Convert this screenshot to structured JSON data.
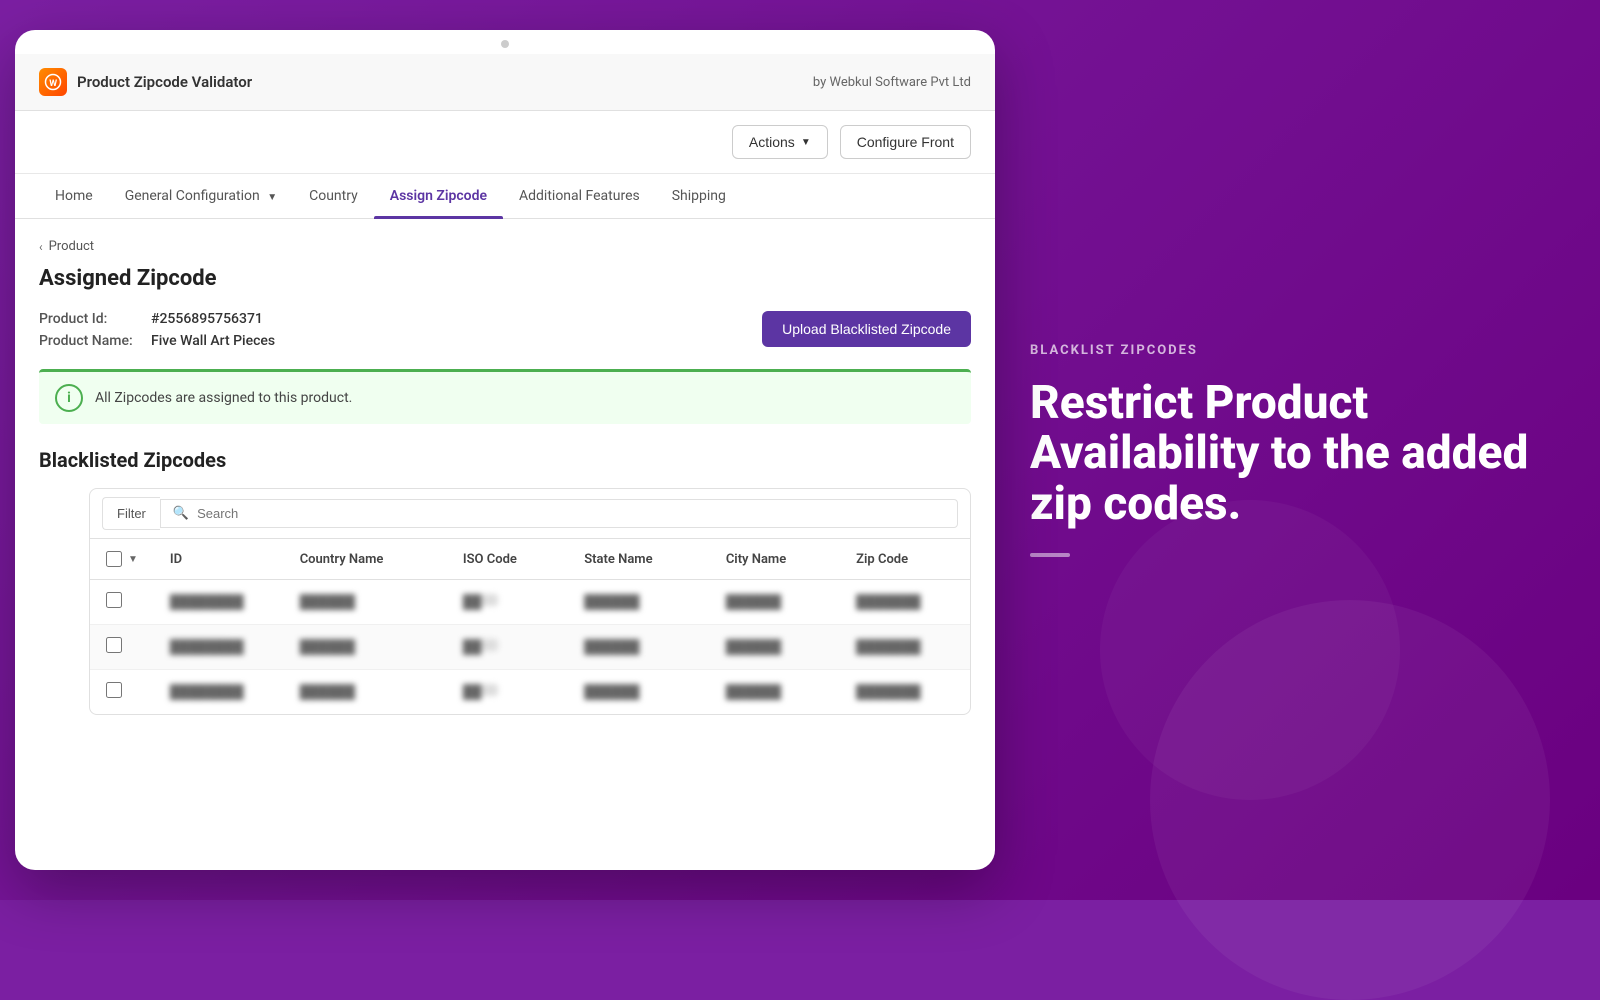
{
  "app": {
    "title": "Product Zipcode Validator",
    "subtitle": "by Webkul Software Pvt Ltd",
    "icon_label": "W"
  },
  "toolbar": {
    "actions_label": "Actions",
    "configure_label": "Configure Front"
  },
  "nav": {
    "items": [
      {
        "id": "home",
        "label": "Home",
        "active": false
      },
      {
        "id": "general-config",
        "label": "General Configuration",
        "has_caret": true,
        "active": false
      },
      {
        "id": "country",
        "label": "Country",
        "active": false
      },
      {
        "id": "assign-zipcode",
        "label": "Assign Zipcode",
        "active": true
      },
      {
        "id": "additional-features",
        "label": "Additional Features",
        "active": false
      },
      {
        "id": "shipping",
        "label": "Shipping",
        "active": false
      }
    ]
  },
  "breadcrumb": {
    "parent": "Product"
  },
  "page": {
    "title": "Assigned Zipcode",
    "product_id_label": "Product Id:",
    "product_id_value": "#2556895756371",
    "product_name_label": "Product Name:",
    "product_name_value": "Five Wall Art Pieces",
    "upload_btn_label": "Upload Blacklisted Zipcode",
    "info_message": "All Zipcodes are assigned to this product.",
    "section_title": "Blacklisted Zipcodes"
  },
  "table": {
    "filter_label": "Filter",
    "search_placeholder": "Search",
    "columns": [
      {
        "id": "id",
        "label": "ID"
      },
      {
        "id": "country_name",
        "label": "Country Name"
      },
      {
        "id": "iso_code",
        "label": "ISO Code"
      },
      {
        "id": "state_name",
        "label": "State Name"
      },
      {
        "id": "city_name",
        "label": "City Name"
      },
      {
        "id": "zip_code",
        "label": "Zip Code"
      }
    ],
    "rows": [
      {
        "id": "████████",
        "country": "██████",
        "iso": "██",
        "state": "██████",
        "city": "██████",
        "zip": "███████"
      },
      {
        "id": "████████",
        "country": "██████",
        "iso": "██",
        "state": "██████",
        "city": "██████",
        "zip": "███████"
      },
      {
        "id": "████████",
        "country": "██████",
        "iso": "██",
        "state": "██████",
        "city": "██████",
        "zip": "███████"
      }
    ]
  },
  "right_panel": {
    "eyebrow": "BLACKLIST ZIPCODES",
    "heading": "Restrict Product Availability to the added zip codes."
  },
  "colors": {
    "accent_purple": "#5c35a3",
    "brand_purple": "#7b1fa2",
    "green": "#4caf50"
  }
}
